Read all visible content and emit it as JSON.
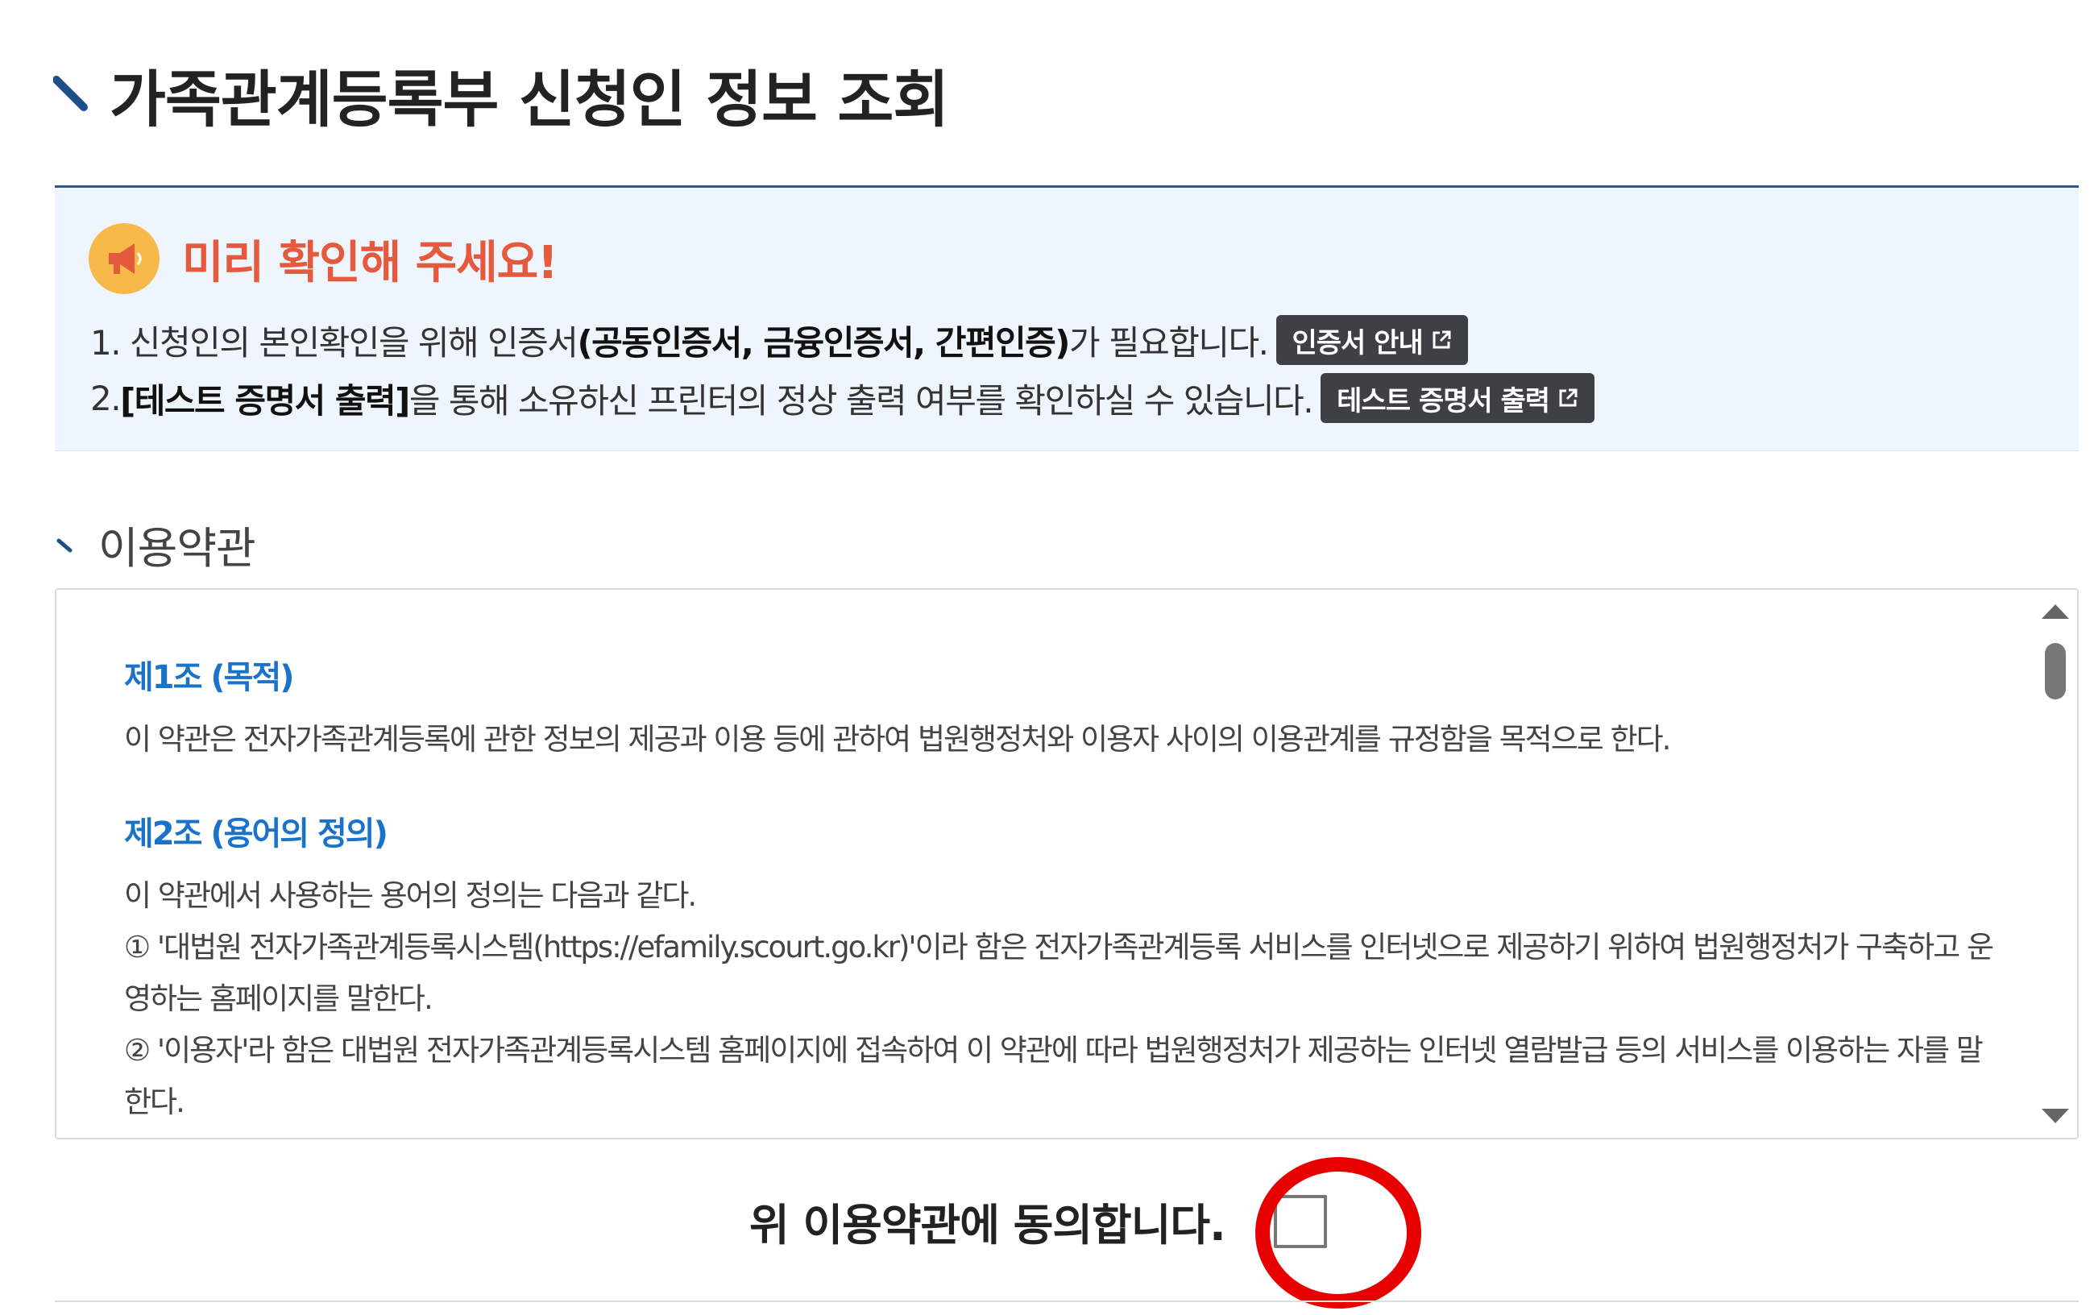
{
  "page": {
    "title": "가족관계등록부 신청인 정보 조회"
  },
  "notice": {
    "heading": "미리 확인해 주세요!",
    "line1": {
      "prefix": "1. 신청인의 본인확인을 위해 인증서",
      "bold": "(공동인증서, 금융인증서, 간편인증)",
      "suffix": "가 필요합니다.",
      "button_label": "인증서 안내"
    },
    "line2": {
      "prefix": "2. ",
      "bold": "[테스트 증명서 출력]",
      "suffix": "을 통해 소유하신 프린터의 정상 출력 여부를 확인하실 수 있습니다.",
      "button_label": "테스트 증명서 출력"
    },
    "icon": "megaphone-icon",
    "accent_color": "#e55a3c"
  },
  "terms": {
    "section_title": "이용약관",
    "articles": [
      {
        "title": "제1조 (목적)",
        "paragraphs": [
          "이 약관은 전자가족관계등록에 관한 정보의 제공과 이용 등에 관하여 법원행정처와 이용자 사이의 이용관계를 규정함을 목적으로 한다."
        ]
      },
      {
        "title": "제2조 (용어의 정의)",
        "paragraphs": [
          "이 약관에서 사용하는 용어의 정의는 다음과 같다.",
          "① '대법원 전자가족관계등록시스템(https://efamily.scourt.go.kr)'이라 함은 전자가족관계등록 서비스를 인터넷으로 제공하기 위하여 법원행정처가 구축하고 운영하는 홈페이지를 말한다.",
          "② '이용자'라 함은 대법원 전자가족관계등록시스템 홈페이지에 접속하여 이 약관에 따라 법원행정처가 제공하는 인터넷 열람발급 등의 서비스를 이용하는 자를 말한다."
        ]
      }
    ],
    "title_color": "#1a73c8"
  },
  "agreement": {
    "label": "위 이용약관에 동의합니다.",
    "checked": false,
    "highlight_color": "#e80000"
  }
}
